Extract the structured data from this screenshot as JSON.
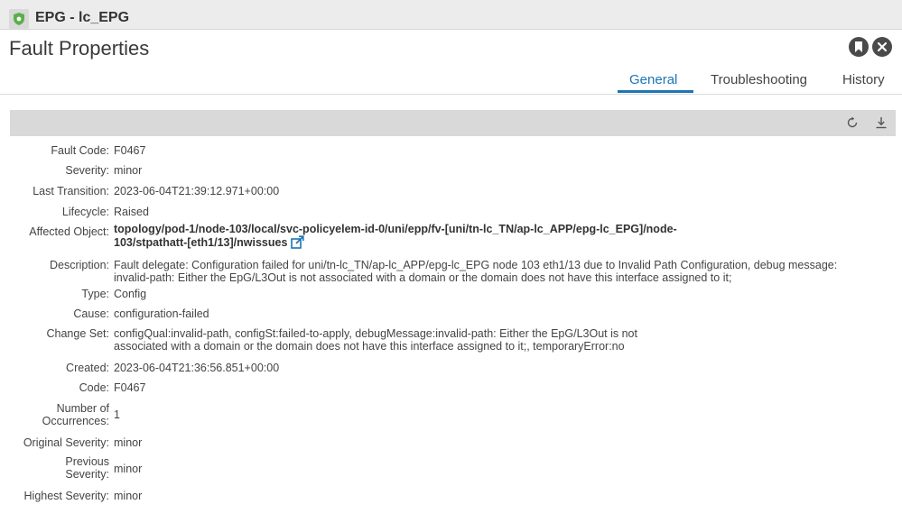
{
  "breadcrumb": {
    "text": "EPG - lc_EPG"
  },
  "header": {
    "title": "Fault Properties"
  },
  "tabs": [
    {
      "label": "General",
      "active": true
    },
    {
      "label": "Troubleshooting",
      "active": false
    },
    {
      "label": "History",
      "active": false
    }
  ],
  "toolbar": {
    "icons": [
      "refresh-icon",
      "download-icon"
    ]
  },
  "properties": {
    "fault_code": {
      "label": "Fault Code:",
      "value": "F0467"
    },
    "severity": {
      "label": "Severity:",
      "value": "minor"
    },
    "last_transition": {
      "label": "Last Transition:",
      "value": "2023-06-04T21:39:12.971+00:00"
    },
    "lifecycle": {
      "label": "Lifecycle:",
      "value": "Raised"
    },
    "affected_object": {
      "label": "Affected Object:",
      "line1": "topology/pod-1/node-103/local/svc-policyelem-id-0/uni/epp/fv-[uni/tn-lc_TN/ap-lc_APP/epg-lc_EPG]/node-",
      "line2": "103/stpathatt-[eth1/13]/nwissues"
    },
    "description": {
      "label": "Description:",
      "line1": "Fault delegate: Configuration failed for uni/tn-lc_TN/ap-lc_APP/epg-lc_EPG node 103 eth1/13 due to Invalid Path Configuration, debug message:",
      "line2": "invalid-path: Either the EpG/L3Out is not associated with a domain or the domain does not have this interface assigned to it;"
    },
    "type": {
      "label": "Type:",
      "value": "Config"
    },
    "cause": {
      "label": "Cause:",
      "value": "configuration-failed"
    },
    "change_set": {
      "label": "Change Set:",
      "line1": "configQual:invalid-path, configSt:failed-to-apply, debugMessage:invalid-path: Either the EpG/L3Out is not",
      "line2": "associated with a domain or the domain does not have this interface assigned to it;, temporaryError:no"
    },
    "created": {
      "label": "Created:",
      "value": "2023-06-04T21:36:56.851+00:00"
    },
    "code": {
      "label": "Code:",
      "value": "F0467"
    },
    "occurrences": {
      "label_line1": "Number of",
      "label_line2": "Occurrences:",
      "value": "1"
    },
    "original_severity": {
      "label": "Original Severity:",
      "value": "minor"
    },
    "previous_severity": {
      "label_line1": "Previous",
      "label_line2": "Severity:",
      "value": "minor"
    },
    "highest_severity": {
      "label": "Highest Severity:",
      "value": "minor"
    }
  },
  "colors": {
    "accent": "#1d75b3",
    "toolbar_bg": "#d9d9d9",
    "icon_green": "#5ab04a"
  }
}
